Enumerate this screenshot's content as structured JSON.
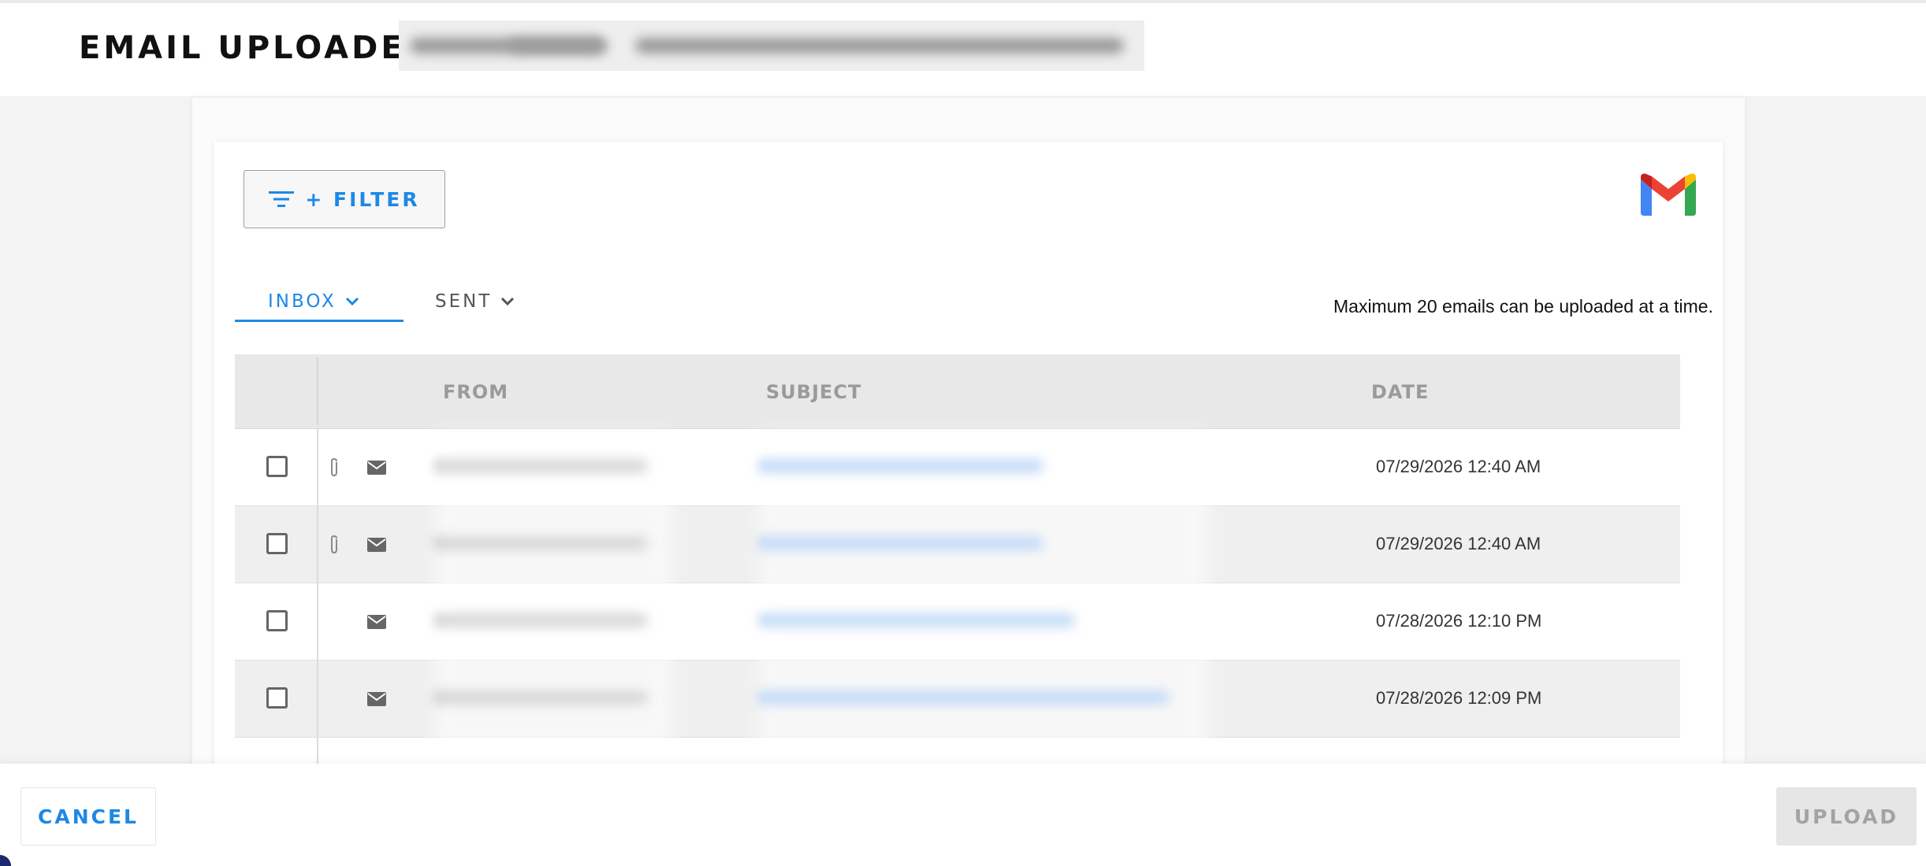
{
  "header": {
    "title": "EMAIL UPLOADER",
    "account_blurred": ""
  },
  "toolbar": {
    "filter_label": "+ FILTER",
    "filter_icon": "filter-list-icon",
    "brand_icon": "gmail-logo"
  },
  "tabs": [
    {
      "label": "INBOX",
      "active": true
    },
    {
      "label": "SENT",
      "active": false
    }
  ],
  "note": "Maximum 20 emails can be uploaded at a time.",
  "table": {
    "headers": {
      "from": "FROM",
      "subject": "SUBJECT",
      "date": "DATE"
    },
    "rows": [
      {
        "has_attachment": true,
        "date": "07/29/2026 12:40 AM"
      },
      {
        "has_attachment": true,
        "date": "07/29/2026 12:40 AM"
      },
      {
        "has_attachment": false,
        "date": "07/28/2026 12:10 PM"
      },
      {
        "has_attachment": false,
        "date": "07/28/2026 12:09 PM"
      }
    ]
  },
  "footer": {
    "cancel_label": "CANCEL",
    "upload_label": "UPLOAD"
  },
  "colors": {
    "accent": "#1e88e5",
    "disabled": "#a3a3a3"
  }
}
